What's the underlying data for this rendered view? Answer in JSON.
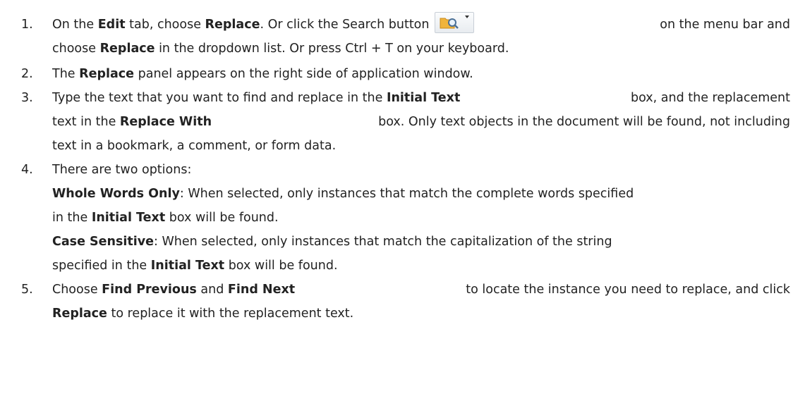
{
  "steps": [
    {
      "number": "1.",
      "line1_a": "On the ",
      "line1_b": "Edit",
      "line1_c": " tab, choose ",
      "line1_d": "Replace",
      "line1_e": ". Or click the Search button",
      "line1_f": "on the menu bar and",
      "line2_a": "choose ",
      "line2_b": "Replace",
      "line2_c": " in the dropdown list. Or press Ctrl + T on your keyboard.",
      "icon": "search-dropdown-icon"
    },
    {
      "number": "2.",
      "a": "The ",
      "b": "Replace",
      "c": " panel appears on the right side of application window."
    },
    {
      "number": "3.",
      "l1_a": "Type the text that you want to find and replace in the ",
      "l1_b": "Initial Text",
      "l1_c": " box, and the replacement",
      "l2_a": "text in the ",
      "l2_b": "Replace With",
      "l2_c": " box. Only text objects in the document will be found, not including",
      "l3": "text in a bookmark, a comment, or form data."
    },
    {
      "number": "4.",
      "intro": "There are two options:",
      "opt1_title": "Whole Words Only",
      "opt1_l1": ": When selected, only instances that match the complete words specified",
      "opt1_l2_a": "in the ",
      "opt1_l2_b": "Initial Text",
      "opt1_l2_c": " box will be found.",
      "opt2_title": "Case Sensitive",
      "opt2_l1": ": When selected, only instances that match the capitalization of the string",
      "opt2_l2_a": "specified in the ",
      "opt2_l2_b": "Initial Text",
      "opt2_l2_c": " box will be found."
    },
    {
      "number": "5.",
      "l1_a": "Choose ",
      "l1_b": "Find Previous",
      "l1_c": " and ",
      "l1_d": "Find Next",
      "l1_e": " to locate the instance you need to replace, and click",
      "l2_a": "Replace",
      "l2_b": " to replace it with the replacement text."
    }
  ]
}
